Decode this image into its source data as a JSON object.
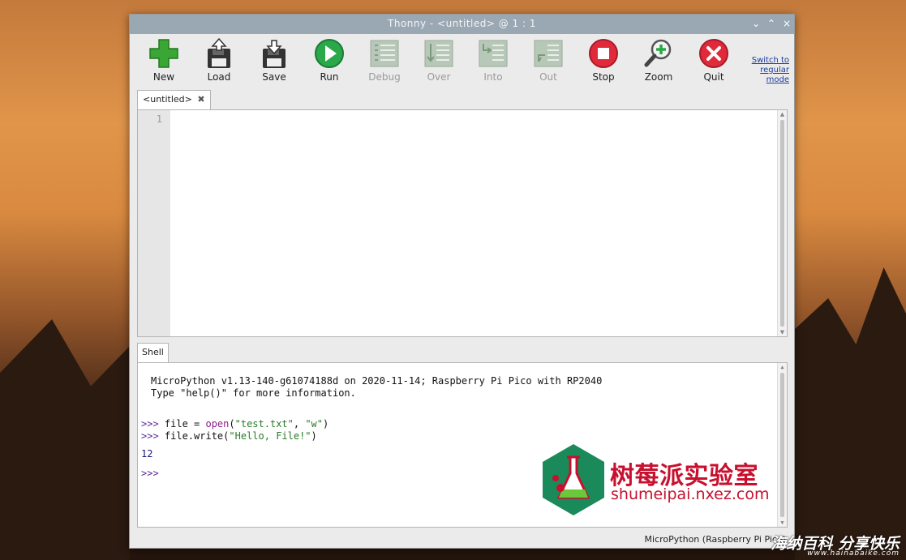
{
  "window": {
    "title": "Thonny  -  <untitled>  @  1 : 1",
    "controls": {
      "minimize": "⌄",
      "maximize": "⌃",
      "close": "×"
    }
  },
  "toolbar": {
    "items": [
      {
        "label": "New",
        "icon": "new-plus-icon",
        "enabled": true
      },
      {
        "label": "Load",
        "icon": "load-floppy-icon",
        "enabled": true
      },
      {
        "label": "Save",
        "icon": "save-floppy-icon",
        "enabled": true
      },
      {
        "label": "Run",
        "icon": "run-play-icon",
        "enabled": true
      },
      {
        "label": "Debug",
        "icon": "debug-icon",
        "enabled": false
      },
      {
        "label": "Over",
        "icon": "step-over-icon",
        "enabled": false
      },
      {
        "label": "Into",
        "icon": "step-into-icon",
        "enabled": false
      },
      {
        "label": "Out",
        "icon": "step-out-icon",
        "enabled": false
      },
      {
        "label": "Stop",
        "icon": "stop-icon",
        "enabled": true
      },
      {
        "label": "Zoom",
        "icon": "zoom-icon",
        "enabled": true
      },
      {
        "label": "Quit",
        "icon": "quit-icon",
        "enabled": true
      }
    ],
    "switch_mode": {
      "line1": "Switch to",
      "line2": "regular",
      "line3": "mode"
    }
  },
  "editor": {
    "tab_label": "<untitled>",
    "tab_close": "✖",
    "line_number": "1"
  },
  "shell": {
    "tab_label": "Shell",
    "banner_line1": "MicroPython v1.13-140-g61074188d on 2020-11-14; Raspberry Pi Pico with RP2040",
    "banner_line2": "Type \"help()\" for more information.",
    "prompt": ">>>",
    "cmd1": {
      "pre": " file = ",
      "fn": "open",
      "open_paren": "(",
      "arg1": "\"test.txt\"",
      "sep": ", ",
      "arg2": "\"w\"",
      "close_paren": ")"
    },
    "cmd2": {
      "pre": " file.write(",
      "arg": "\"Hello, File!\"",
      "close": ")"
    },
    "output": "12"
  },
  "status": {
    "interpreter": "MicroPython (Raspberry Pi Pico)"
  },
  "watermarks": {
    "lab_name": "树莓派实验室",
    "lab_url": "shumeipai.nxez.com",
    "corner_big": "海纳百科 分享快乐",
    "corner_small": "www.hainabaike.com"
  }
}
